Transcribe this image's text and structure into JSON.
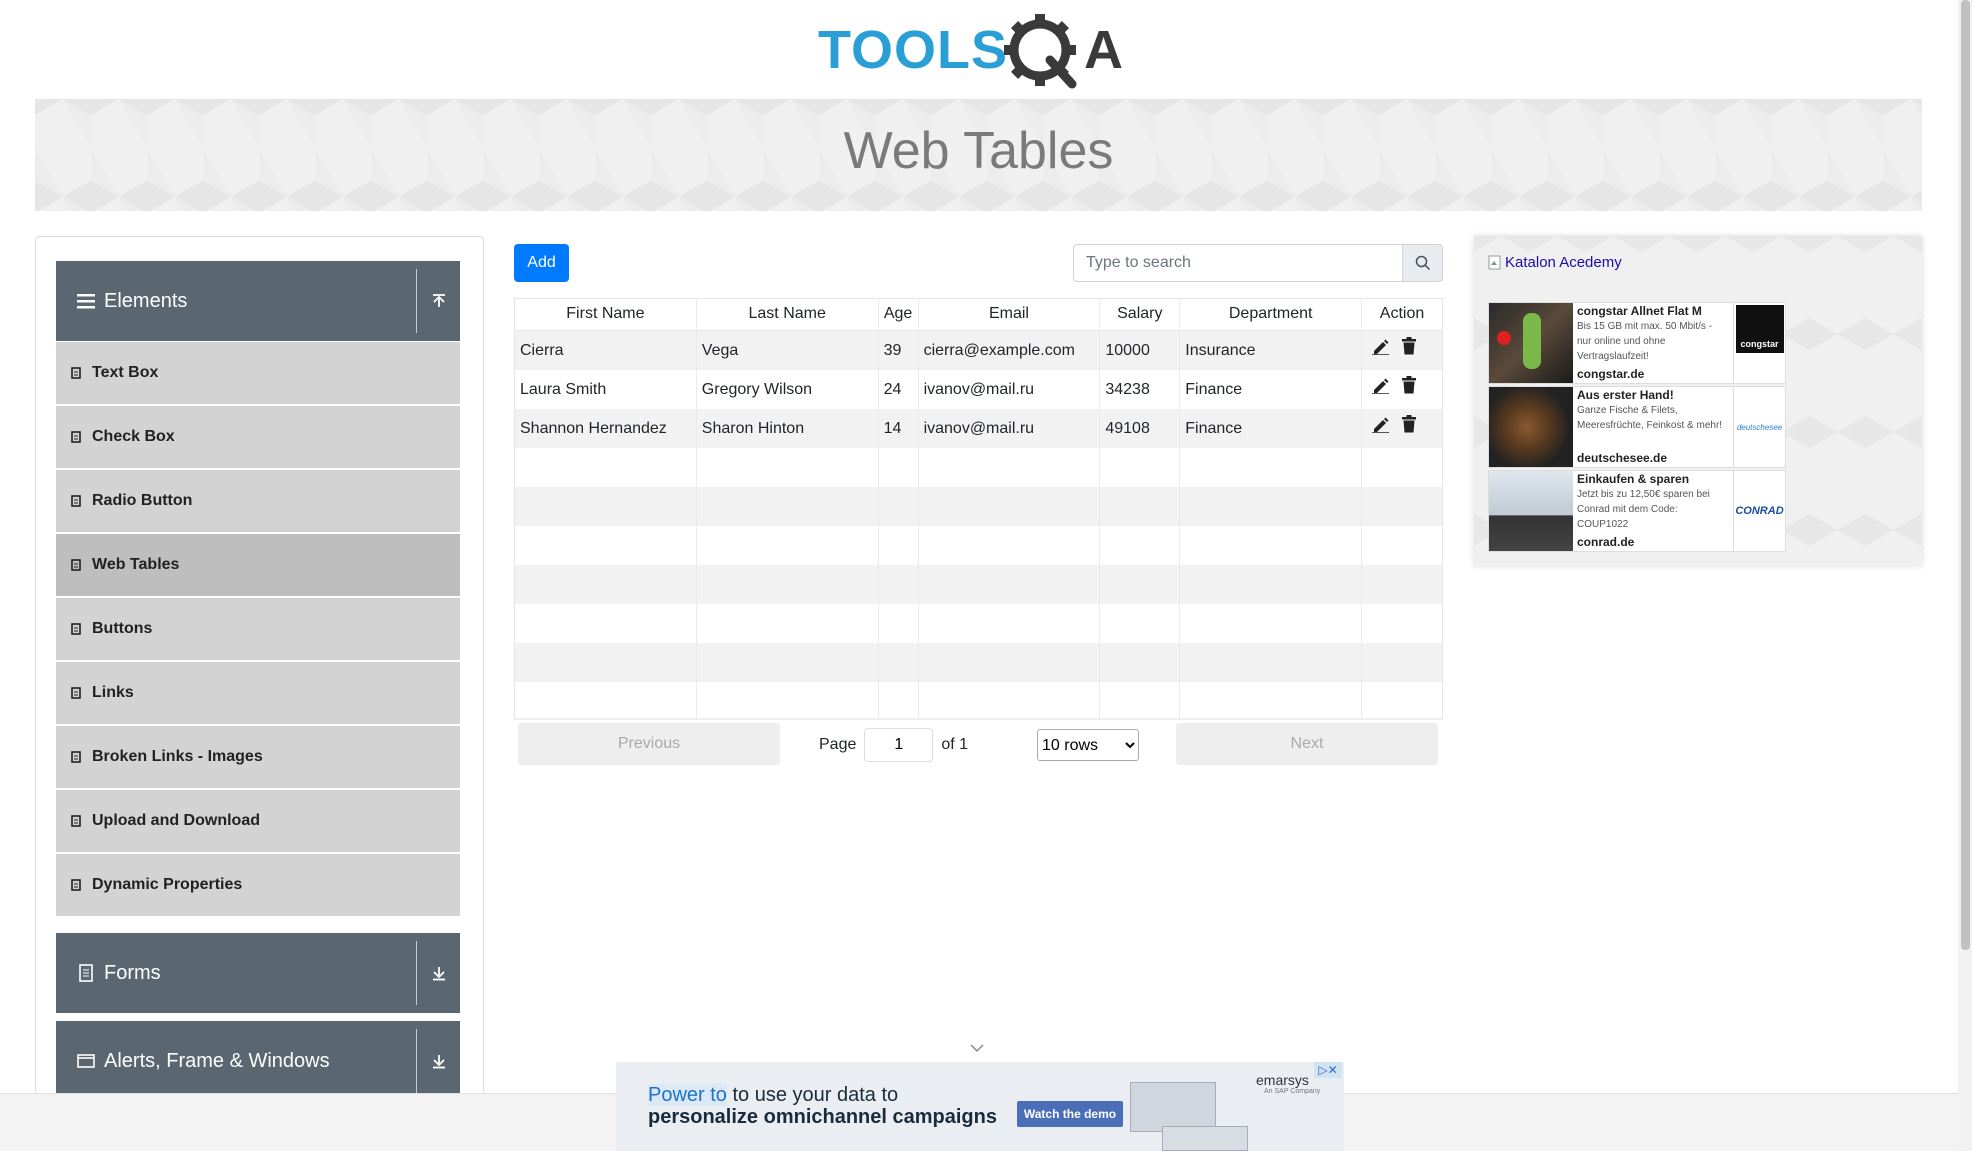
{
  "page": {
    "title": "Web Tables"
  },
  "sidebar": {
    "elements_label": "Elements",
    "items": [
      {
        "label": "Text Box"
      },
      {
        "label": "Check Box"
      },
      {
        "label": "Radio Button"
      },
      {
        "label": "Web Tables"
      },
      {
        "label": "Buttons"
      },
      {
        "label": "Links"
      },
      {
        "label": "Broken Links - Images"
      },
      {
        "label": "Upload and Download"
      },
      {
        "label": "Dynamic Properties"
      }
    ],
    "active_item": "Web Tables",
    "forms_label": "Forms",
    "alerts_label": "Alerts, Frame & Windows"
  },
  "toolbar": {
    "add_label": "Add",
    "search_placeholder": "Type to search"
  },
  "table": {
    "columns": [
      "First Name",
      "Last Name",
      "Age",
      "Email",
      "Salary",
      "Department",
      "Action"
    ],
    "rows": [
      [
        "Cierra",
        "Vega",
        "39",
        "cierra@example.com",
        "10000",
        "Insurance"
      ],
      [
        "Laura Smith",
        "Gregory Wilson",
        "24",
        "ivanov@mail.ru",
        "34238",
        "Finance"
      ],
      [
        "Shannon Hernandez",
        "Sharon Hinton",
        "14",
        "ivanov@mail.ru",
        "49108",
        "Finance"
      ]
    ],
    "empty_row_count": 7
  },
  "pagination": {
    "previous": "Previous",
    "page_label": "Page",
    "page_value": "1",
    "of_label": "of 1",
    "rows_option": "10 rows",
    "next": "Next"
  },
  "side_ad": {
    "link_text": "Katalon Acedemy",
    "cards": [
      {
        "title": "congstar Allnet Flat M",
        "desc": "Bis 15 GB mit max. 50 Mbit/s - nur online und ohne Vertragslaufzeit!",
        "domain": "congstar.de",
        "logo_text": "congstar"
      },
      {
        "title": "Aus erster Hand!",
        "desc": "Ganze Fische & Filets, Meeresfrüchte, Feinkost & mehr!",
        "domain": "deutschesee.de",
        "logo_text": "deutschesee"
      },
      {
        "title": "Einkaufen & sparen",
        "desc": "Jetzt bis zu 12,50€ sparen bei Conrad mit dem Code: COUP1022",
        "domain": "conrad.de",
        "logo_text": "CONRAD"
      }
    ]
  },
  "bottom_ad": {
    "highlight": "Power to",
    "line1_rest": " to use your data to",
    "line2": "personalize omnichannel campaigns",
    "cta": "Watch the demo",
    "brand": "emarsys",
    "brand_sub": "An SAP Company"
  },
  "colors": {
    "primary": "#007bff",
    "sidebar_header": "#5a6670",
    "menu_item": "#d3d3d3"
  }
}
